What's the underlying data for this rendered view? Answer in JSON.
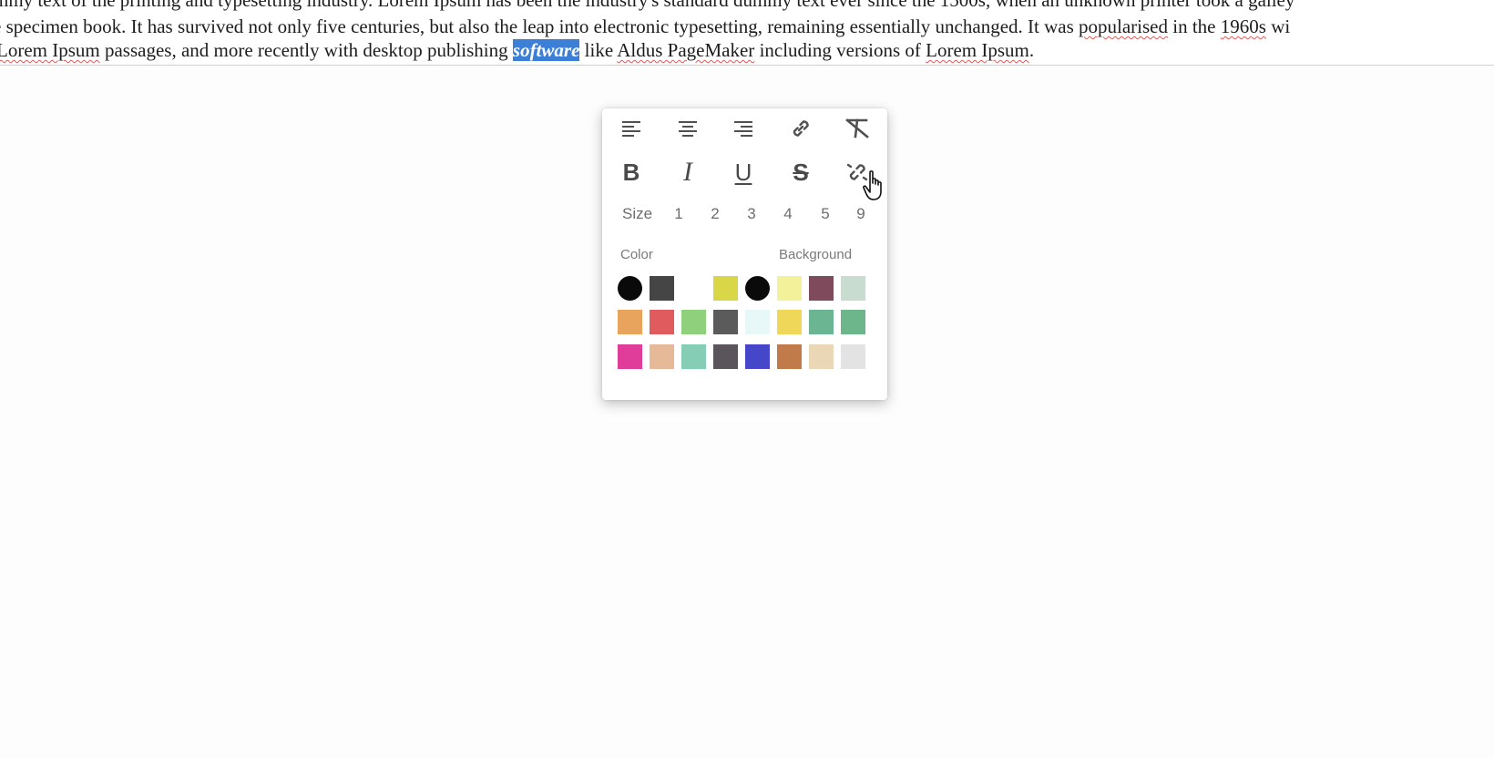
{
  "document": {
    "line1": "mmy text of the printing and typesetting industry. Lorem Ipsum has been the industry's standard dummy text ever since the 1500s, when an unknown printer took a galley",
    "line2": {
      "a": "e specimen book. It has survived not only five centuries, but also the leap into electronic typesetting, remaining essentially unchanged. It was ",
      "b": "popularised",
      "c": " in the ",
      "d": "1960s",
      "e": " wi"
    },
    "line3": {
      "a": " ",
      "b": "Lorem Ipsum",
      "c": " passages, and more recently with desktop publishing ",
      "selected": "software",
      "d": " like ",
      "e": "Aldus PageMaker",
      "f": " including versions of ",
      "g": "Lorem Ipsum",
      "h": "."
    }
  },
  "toolbar": {
    "row1": [
      "align-left-icon",
      "align-center-icon",
      "align-right-icon",
      "link-icon",
      "clear-format-icon"
    ],
    "row2": {
      "bold_label": "B",
      "italic_label": "I",
      "underline_label": "U",
      "strike_label": "S",
      "unlink_icon": "unlink-icon"
    },
    "size": {
      "label": "Size",
      "options": [
        "1",
        "2",
        "3",
        "4",
        "5",
        "9"
      ]
    },
    "color_label": "Color",
    "background_label": "Background",
    "swatches": [
      [
        "#0a0a0a",
        "#454545",
        "#ffffff",
        "#d9d648",
        "#0a0a0a",
        "#f3f29a",
        "#7e4a5c",
        "#c9dcd0"
      ],
      [
        "#e8a45c",
        "#e05b5e",
        "#8fd07c",
        "#5b5b5b",
        "#e8f8f8",
        "#efd75a",
        "#6bb592",
        "#6db58a"
      ],
      [
        "#df3d99",
        "#e6b999",
        "#86cdb6",
        "#5a555a",
        "#4646c8",
        "#c17a4a",
        "#ead7b6",
        "#e3e3e3"
      ]
    ]
  }
}
